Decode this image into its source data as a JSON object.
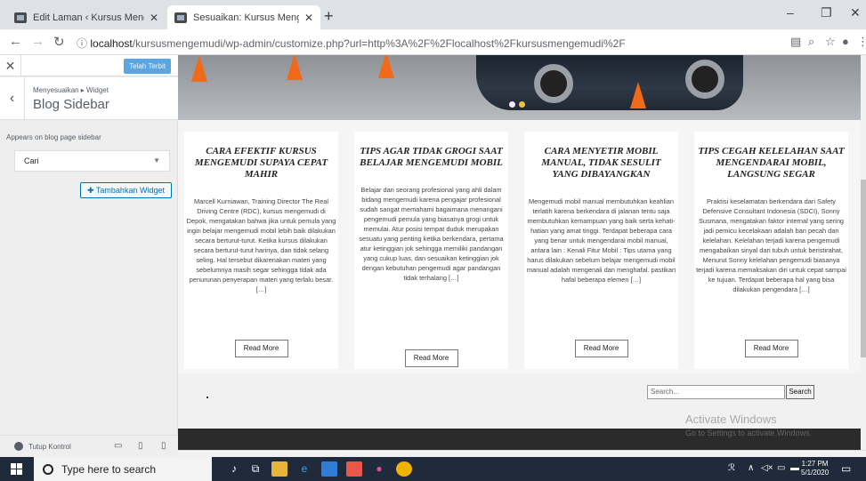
{
  "browser": {
    "tabs": [
      {
        "title": "Edit Laman ‹ Kursus Mengemudi",
        "active": false
      },
      {
        "title": "Sesuaikan: Kursus Mengemudi S",
        "active": true
      }
    ],
    "new_tab": "+",
    "url_scheme_icon": "ⓘ",
    "url_host": "localhost",
    "url_rest": "/kursusmengemudi/wp-admin/customize.php?url=http%3A%2F%2Flocalhost%2Fkursusmengemudi%2F",
    "window_controls": {
      "minimize": "–",
      "maximize": "❐",
      "close": "✕"
    }
  },
  "customizer": {
    "publish_label": "Telah Terbit",
    "breadcrumb": "Menyesuaikan ▸ Widget",
    "section_title": "Blog Sidebar",
    "appears_text": "Appears on blog page sidebar",
    "widget_name": "Cari",
    "add_widget_label": "Tambahkan Widget",
    "hide_controls_label": "Tutup Kontrol"
  },
  "posts": [
    {
      "title": "CARA EFEKTIF KURSUS MENGEMUDI SUPAYA CEPAT MAHIR",
      "excerpt": "Marcell Kurniawan, Training Director The Real Driving Centre (RDC), kursus mengemudi di Depok, mengatakan bahwa jika untuk pemula yang ingin belajar mengemudi mobil lebih baik dilakukan secara berturut-turut. Ketika kursus dilakukan secara berturut-turut harinya, dan tidak selang seling. Hal tersebut dikarenakan materi yang sebelumnya masih segar sehingga tidak ada penurunan penyerapan materi yang terlalu besar. […]",
      "read_more": "Read More"
    },
    {
      "title": "TIPS AGAR TIDAK GROGI SAAT BELAJAR MENGEMUDI MOBIL",
      "excerpt": "Belajar dari seorang profesional yang ahli dalam bidang mengemudi karena pengajar profesional sudah sangat memahami bagaimana menangani pengemudi pemula yang biasanya grogi untuk memulai. Atur posisi tempat duduk merupakan sesuatu yang penting ketika berkendara, pertama atur ketinggian jok sehingga memiliki pandangan yang cukup luas, dan sesuaikan ketinggian jok dengan kebutuhan pengemudi agar pandangan tidak terhalang […]",
      "read_more": "Read More"
    },
    {
      "title": "CARA MENYETIR MOBIL MANUAL, TIDAK SESULIT YANG DIBAYANGKAN",
      "excerpt": "Mengemudi mobil manual membutuhkan keahlian terlatih karena berkendara di jalanan tentu saja membutuhkan kemampuan yang baik serta kehati-hatian yang amat tinggi. Terdapat beberapa cara yang benar untuk mengendarai mobil manual, antara lain : Kenali Fitur Mobil : Tips utama yang harus dilakukan sebelum belajar mengemudi mobil manual adalah mengenali dan menghafal. pastikan hafal beberapa elemen […]",
      "read_more": "Read More"
    },
    {
      "title": "TIPS CEGAH KELELAHAN SAAT MENGENDARAI MOBIL, LANGSUNG SEGAR",
      "excerpt": "Praktisi keselamatan berkendara dari Safety Defensive Consultant Indonesia (SDCI), Sonny Susmana, mengatakan faktor internal yang sering jadi pemicu kecelakaan adalah ban pecah dan kelelahan. Kelelahan terjadi karena pengemudi mengabaikan sinyal dari tubuh untuk beristirahat, Menurut Sonny kelelahan pengemudi biasanya terjadi karena memaksakan diri untuk cepat sampai ke tujuan. Terdapat beberapa hal yang bisa dilakukan pengendara […]",
      "read_more": "Read More"
    }
  ],
  "footer": {
    "search_placeholder": "Search...",
    "search_button": "Search"
  },
  "watermark": {
    "title": "Activate Windows",
    "subtitle": "Go to Settings to activate Windows."
  },
  "taskbar": {
    "search_placeholder": "Type here to search",
    "time": "1:27 PM",
    "date": "5/1/2020"
  }
}
